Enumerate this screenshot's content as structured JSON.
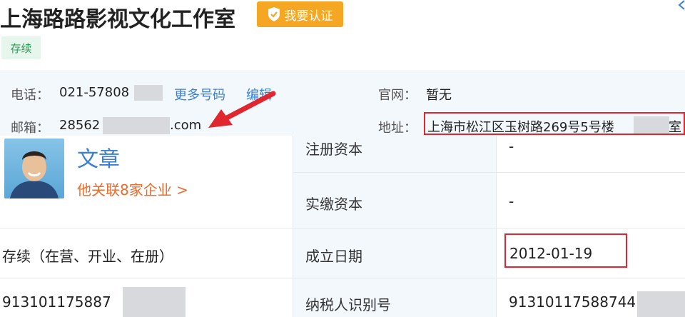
{
  "header": {
    "company_name": "上海路路影视文化工作室",
    "certify_button": "我要认证",
    "status_tag": "存续"
  },
  "contact": {
    "phone_label": "电话：",
    "phone_value": "021-57808",
    "more_numbers_link": "更多号码",
    "edit_link": "编辑",
    "website_label": "官网：",
    "website_value": "暂无",
    "email_label": "邮箱：",
    "email_prefix": "28562",
    "email_suffix": ".com",
    "address_label": "地址：",
    "address_value": "上海市松江区玉树路269号5号楼",
    "address_suffix": "室"
  },
  "person": {
    "name": "文章",
    "related_companies": "他关联8家企业 >"
  },
  "table": {
    "registered_capital_label": "注册资本",
    "registered_capital_value": "-",
    "paid_capital_label": "实缴资本",
    "paid_capital_value": "-",
    "status_value": "存续（在营、开业、在册）",
    "founded_label": "成立日期",
    "founded_value": "2012-01-19",
    "credit_code_value": "913101175887",
    "taxpayer_label": "纳税人识别号",
    "taxpayer_value": "91310117588744"
  },
  "colors": {
    "accent_blue": "#3a7fd4",
    "certify_orange": "#f5a623",
    "status_green": "#2e9a54",
    "highlight_red": "#e0262e"
  },
  "icons": {
    "certify": "shield-check-icon",
    "top_right": "chevron-left-icon",
    "annotation": "red-arrow-icon"
  }
}
